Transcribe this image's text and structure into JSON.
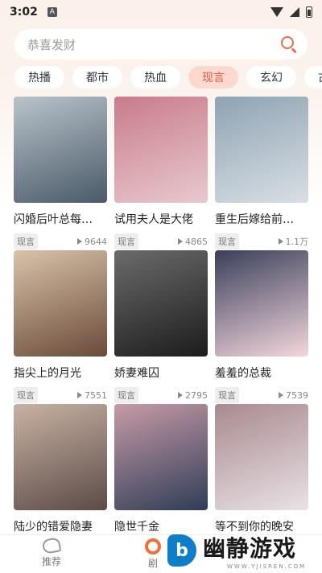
{
  "status_bar": {
    "time": "3:02",
    "notification_glyph": "A"
  },
  "search": {
    "placeholder": "恭喜发财"
  },
  "tabs": [
    {
      "label": "热播",
      "active": false
    },
    {
      "label": "都市",
      "active": false
    },
    {
      "label": "热血",
      "active": false
    },
    {
      "label": "现言",
      "active": true
    },
    {
      "label": "玄幻",
      "active": false
    },
    {
      "label": "古",
      "active": false
    }
  ],
  "dramas": [
    {
      "title": "闪婚后叶总每…",
      "tag": "现言",
      "views": "9644",
      "cover_text": "",
      "cover_colors": [
        "#4a5a68",
        "#b9c3cb"
      ]
    },
    {
      "title": "试用夫人是大佬",
      "tag": "现言",
      "views": "4865",
      "cover_text": "",
      "cover_colors": [
        "#e9c9cf",
        "#c77c8a"
      ]
    },
    {
      "title": "重生后嫁给前…",
      "tag": "现言",
      "views": "1.1万",
      "cover_text": "",
      "cover_colors": [
        "#d9dfe4",
        "#8fa3b3"
      ]
    },
    {
      "title": "指尖上的月光",
      "tag": "现言",
      "views": "7551",
      "cover_text": "",
      "cover_colors": [
        "#6b4a3a",
        "#d8c3a8"
      ]
    },
    {
      "title": "娇妻难囚",
      "tag": "现言",
      "views": "2795",
      "cover_text": "",
      "cover_colors": [
        "#1c1c1c",
        "#6b6b6b"
      ]
    },
    {
      "title": "羞羞的总裁",
      "tag": "现言",
      "views": "7539",
      "cover_text": "",
      "cover_colors": [
        "#f2d7dc",
        "#3a3f5a"
      ]
    },
    {
      "title": "陆少的错爱隐妻",
      "tag": "现言",
      "views": "",
      "cover_text": "",
      "cover_colors": [
        "#5b4b47",
        "#c9b2a4"
      ]
    },
    {
      "title": "隐世千金",
      "tag": "现言",
      "views": "",
      "cover_text": "",
      "cover_colors": [
        "#2f3d57",
        "#c79ba6"
      ]
    },
    {
      "title": "等不到你的晚安",
      "tag": "现言",
      "views": "",
      "cover_text": "",
      "cover_colors": [
        "#e8e2e6",
        "#a98a8f"
      ]
    }
  ],
  "bottom_nav": [
    {
      "label": "推荐",
      "icon": "recommend-icon",
      "active": false
    },
    {
      "label": "剧",
      "icon": "theater-icon",
      "active": true
    }
  ],
  "watermark": {
    "logo_glyph": "b",
    "main": "幽静游戏",
    "sub": "WWW.YJISREN.COM"
  },
  "colors": {
    "accent": "#e8563d",
    "tab_active_bg": "#fbd9cf"
  }
}
